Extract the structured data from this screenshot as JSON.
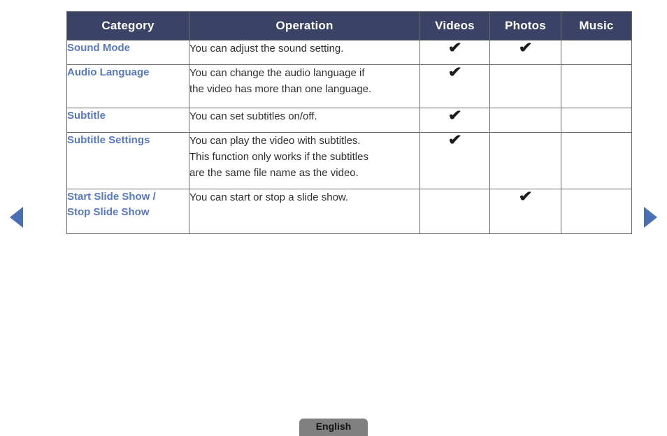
{
  "nav": {
    "prev_icon": "triangle-left-icon",
    "next_icon": "triangle-right-icon",
    "arrow_color": "#4A6FB5"
  },
  "table": {
    "header_bg": "#3A4266",
    "header_text_color": "#FFFFFF",
    "category_text_color": "#5878C0",
    "border_color": "#6A6A6A",
    "columns": [
      "Category",
      "Operation",
      "Videos",
      "Photos",
      "Music"
    ],
    "rows": [
      {
        "category": "Sound Mode",
        "operation": "You can adjust the sound setting.",
        "videos": "✔",
        "photos": "✔",
        "music": ""
      },
      {
        "category": "Audio Language",
        "operation": "You can change the audio language if\nthe video has more than one language.",
        "videos": "✔",
        "photos": "",
        "music": ""
      },
      {
        "category": "Subtitle",
        "operation": "You can set subtitles on/off.",
        "videos": "✔",
        "photos": "",
        "music": ""
      },
      {
        "category": "Subtitle Settings",
        "operation": "You can play the video with subtitles.\nThis function only works if the subtitles\nare the same file name as the video.",
        "videos": "✔",
        "photos": "",
        "music": ""
      },
      {
        "category": "Start Slide Show /\nStop Slide Show",
        "operation": "You can start or stop a slide show.",
        "videos": "",
        "photos": "✔",
        "music": ""
      }
    ]
  },
  "footer": {
    "language_label": "English",
    "button_bg": "#808080"
  }
}
